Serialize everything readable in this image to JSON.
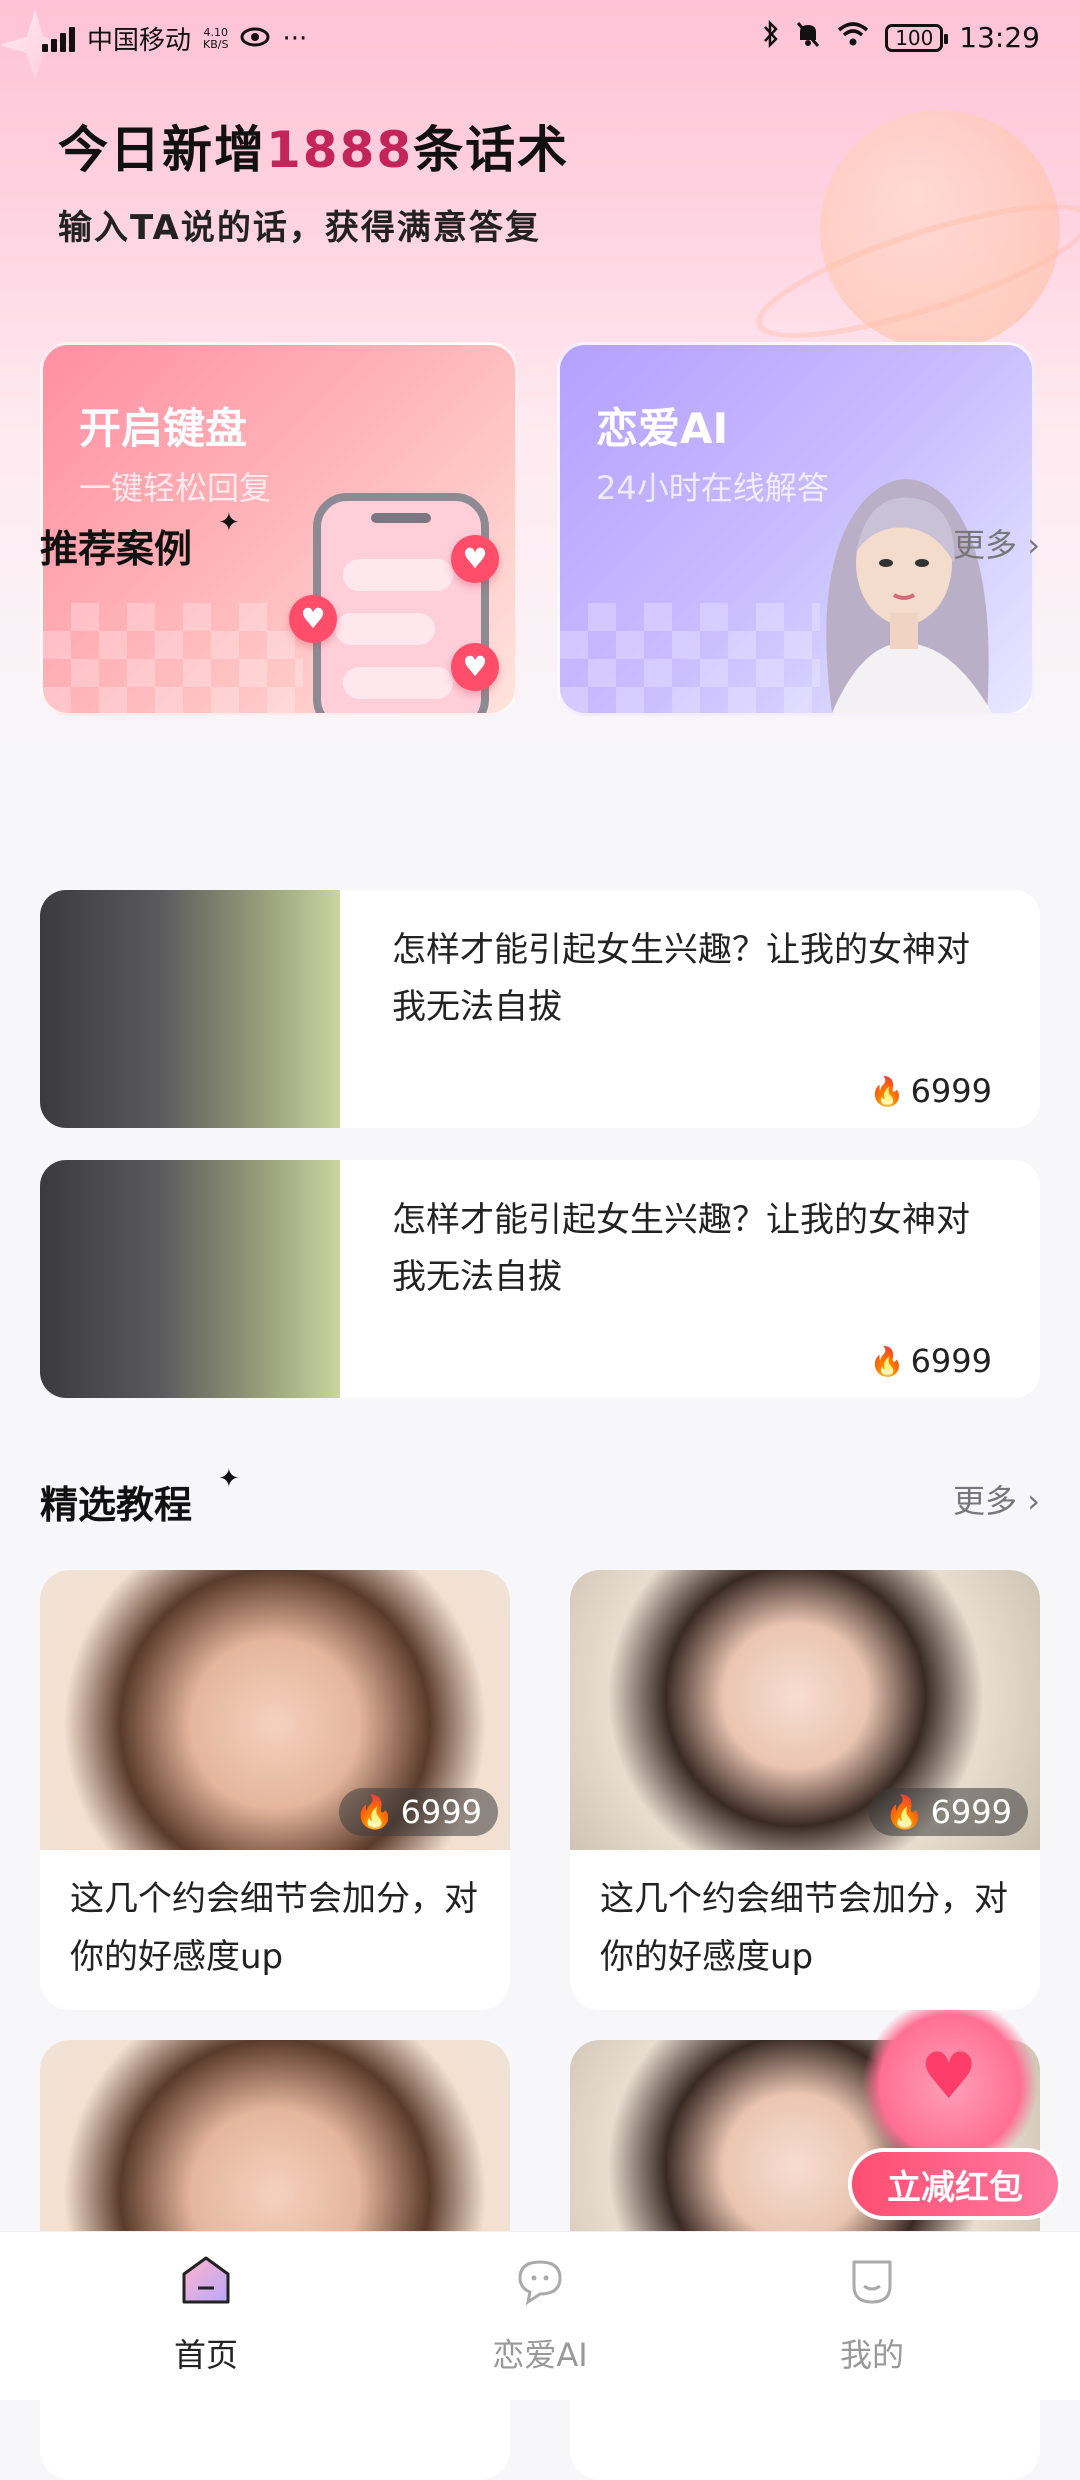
{
  "status_bar": {
    "carrier": "中国移动",
    "net_speed_value": "4.10",
    "net_speed_unit": "KB/S",
    "more": "···",
    "battery": "100",
    "time": "13:29"
  },
  "header": {
    "headline_prefix": "今日新增",
    "headline_number": "1888",
    "headline_suffix": "条话术",
    "subline": "输入TA说的话，获得满意答复"
  },
  "features": [
    {
      "title": "开启键盘",
      "subtitle": "一键轻松回复"
    },
    {
      "title": "恋爱AI",
      "subtitle": "24小时在线解答"
    }
  ],
  "recommended": {
    "title": "推荐案例",
    "more": "更多",
    "items": [
      {
        "text": "怎样才能引起女生兴趣？让我的女神对我无法自拔",
        "likes": "6999"
      },
      {
        "text": "怎样才能引起女生兴趣？让我的女神对我无法自拔",
        "likes": "6999"
      }
    ]
  },
  "tutorials": {
    "title": "精选教程",
    "more": "更多",
    "items": [
      {
        "text": "这几个约会细节会加分，对你的好感度up",
        "likes": "6999"
      },
      {
        "text": "这几个约会细节会加分，对你的好感度up",
        "likes": "6999"
      }
    ]
  },
  "promo": {
    "label": "立减红包"
  },
  "tabbar": {
    "items": [
      {
        "label": "首页",
        "active": true
      },
      {
        "label": "恋爱AI",
        "active": false
      },
      {
        "label": "我的",
        "active": false
      }
    ]
  },
  "colors": {
    "accent": "#c3245a",
    "flame": "#ff4b4b",
    "promo": "#ff4d72"
  }
}
